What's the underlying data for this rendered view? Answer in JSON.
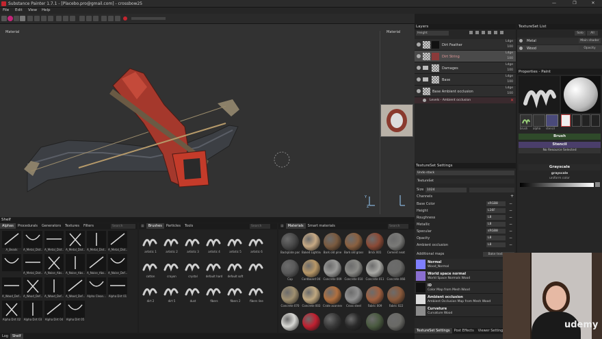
{
  "window": {
    "title": "Substance Painter 1.7.1 - [Placebo.pro@gmail.com] - crossbow25",
    "minimize": "—",
    "maximize": "❐",
    "close": "✕"
  },
  "menu": [
    "File",
    "Edit",
    "View",
    "Help"
  ],
  "viewport": {
    "label_left": "Material",
    "label_right": "Material",
    "axis_y": "Y",
    "axis_z": "Z"
  },
  "layers": {
    "title": "Layers",
    "channel": "Height",
    "items": [
      {
        "name": "Dirt Feather",
        "blend": "Ldge",
        "opacity": "100",
        "type": "paint",
        "selected": false
      },
      {
        "name": "Dirt String",
        "blend": "Ldge",
        "opacity": "100",
        "type": "paint",
        "selected": true
      },
      {
        "name": "Damages",
        "blend": "Ldge",
        "opacity": "100",
        "type": "folder",
        "selected": false
      },
      {
        "name": "Base",
        "blend": "Ldge",
        "opacity": "100",
        "type": "folder",
        "selected": false
      },
      {
        "name": "Base Ambient occlusion",
        "blend": "Ldge",
        "opacity": "100",
        "type": "paint",
        "selected": false
      }
    ],
    "effect": "Levels - Ambient occlusion"
  },
  "textureset_list": {
    "title": "TextureSet List",
    "solo": "Solo",
    "all": "All",
    "items": [
      {
        "name": "Metal",
        "shader": "Main shader"
      },
      {
        "name": "Wood",
        "shader": "Opacity"
      }
    ]
  },
  "properties": {
    "title": "Properties - Paint",
    "slots": [
      "brush",
      "alpha",
      "stencil"
    ],
    "sections": {
      "brush": "Brush",
      "stencil": "Stencil",
      "no_resource": "No Resource Selected",
      "grayscale": "Grayscale",
      "grayscale_sub": "grayscale",
      "uniform": "uniform color"
    }
  },
  "textureset_settings": {
    "title": "TextureSet Settings",
    "undo": "Undo stack",
    "textureset": "TextureSet",
    "size_label": "Size",
    "size_value": "1024",
    "channels_label": "Channels",
    "channels": [
      {
        "name": "Base Color",
        "format": "sRGB8"
      },
      {
        "name": "Height",
        "format": "L16F"
      },
      {
        "name": "Roughness",
        "format": "L8"
      },
      {
        "name": "Metallic",
        "format": "L8"
      },
      {
        "name": "Specular",
        "format": "sRGB8"
      },
      {
        "name": "Opacity",
        "format": "L8"
      },
      {
        "name": "Ambient occlusion",
        "format": "L8"
      }
    ],
    "additional_maps": "Additional maps",
    "bake": "Bake textures",
    "maps": [
      {
        "name": "Normal",
        "desc": "Wood_Normal",
        "color": "#7f7fff"
      },
      {
        "name": "World space normal",
        "desc": "World Space Normals Wood",
        "color": "#8a6fd0"
      },
      {
        "name": "ID",
        "desc": "Color Map from Mesh Wood",
        "color": "#111111"
      },
      {
        "name": "Ambient occlusion",
        "desc": "Ambient Occlusion Map from Mesh Wood",
        "color": "#dddddd"
      },
      {
        "name": "Curvature",
        "desc": "Curvature Wood",
        "color": "#8c8c8c"
      }
    ],
    "bottom_tabs": [
      "TextureSet Settings",
      "Post Effects",
      "Viewer Settings"
    ]
  },
  "shelf": {
    "title": "Shelf",
    "tabs": [
      "Alphas",
      "Procedurals",
      "Generators",
      "Textures",
      "Filters"
    ],
    "search": "Search",
    "alphas": [
      "A_Beads",
      "A_Metal_Dist...",
      "A_Metal_Dist...",
      "A_Metal_Dist...",
      "A_Metal_Dist...",
      "A_Metal_Dist...",
      "",
      "A_Metal_Dist...",
      "A_Noise_Abs...",
      "A_Noise_Abs...",
      "A_Noise_Abs...",
      "A_Noise_Def...",
      "A_Wood_Def...",
      "A_Wood_Def...",
      "A_Wood_Def...",
      "A_Wood_Def...",
      "Alpha Clean...",
      "Alpha Dirt 01",
      "Alpha Dirt 02",
      "Alpha Dirt 03",
      "Alpha Dirt 04",
      "Alpha Dirt 05"
    ],
    "brush_tabs": [
      "Brushes",
      "Particles",
      "Tools"
    ],
    "brushes": [
      "artistic 1",
      "artistic 2",
      "artistic 3",
      "artistic 4",
      "artistic 5",
      "artistic 6",
      "cotton",
      "crayon",
      "crystal",
      "default hard",
      "default soft",
      "",
      "dirt 2",
      "dirt 5",
      "dust",
      "fibers",
      "fibers 2",
      "fibers line"
    ],
    "material_tab": "Materials",
    "smart_tab": "Smart materials",
    "materials": [
      {
        "name": "Backplate pad...",
        "color": "#4a4a4a"
      },
      {
        "name": "Baked Lighting...",
        "color": "#c7a984"
      },
      {
        "name": "Bark old pine",
        "color": "#7a5a3f"
      },
      {
        "name": "Bark old grass",
        "color": "#8a6040"
      },
      {
        "name": "Brick 001",
        "color": "#8a4a36"
      },
      {
        "name": "Cement neat",
        "color": "#7a7a78"
      },
      {
        "name": "Cap",
        "color": "#5a5a5a"
      },
      {
        "name": "Cardboard 001",
        "color": "#b89868"
      },
      {
        "name": "Concrete 009",
        "color": "#9a9a98"
      },
      {
        "name": "Concrete 010",
        "color": "#8a8a86"
      },
      {
        "name": "Concrete 011",
        "color": "#a8a8a4"
      },
      {
        "name": "Concrete 066",
        "color": "#6a6a68"
      },
      {
        "name": "Concrete 070",
        "color": "#a09070"
      },
      {
        "name": "Concrete 003",
        "color": "#c0a880"
      },
      {
        "name": "Crate aconnex",
        "color": "#b07040"
      },
      {
        "name": "Cross steel",
        "color": "#909090"
      },
      {
        "name": "Fabric 009",
        "color": "#a06040"
      },
      {
        "name": "Fabric 022",
        "color": "#8a5a3c"
      },
      {
        "name": "",
        "color": "#d8d8d4"
      },
      {
        "name": "",
        "color": "#c02030"
      },
      {
        "name": "",
        "color": "#3a3a3a"
      },
      {
        "name": "",
        "color": "#2a2a2a"
      },
      {
        "name": "",
        "color": "#4a5a40"
      },
      {
        "name": "",
        "color": "#6a6a66"
      }
    ]
  },
  "bottom_tabs": [
    "Log",
    "Shelf"
  ],
  "watermark": "udemy"
}
